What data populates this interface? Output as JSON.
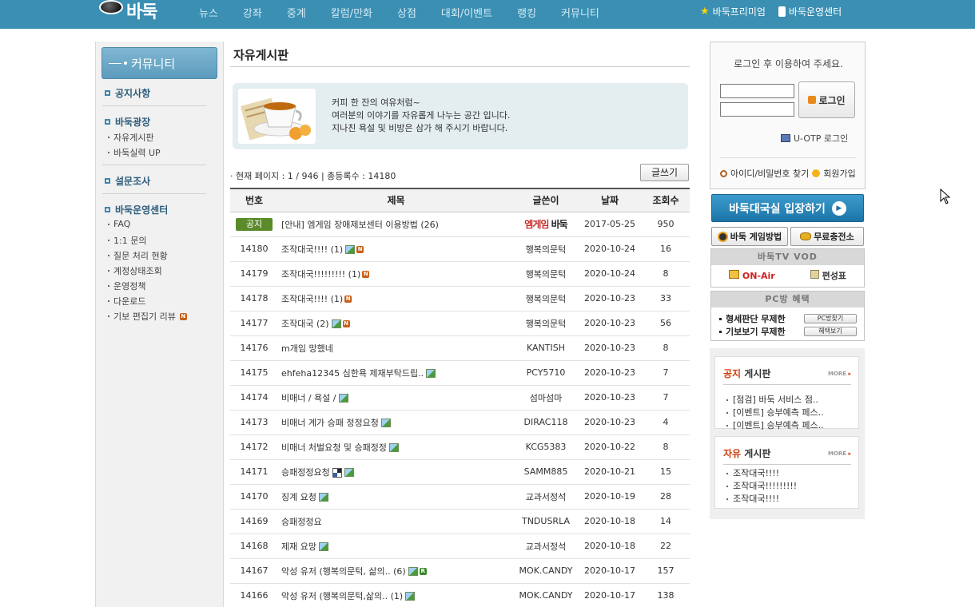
{
  "header": {
    "logo_text": "바둑",
    "nav": [
      "뉴스",
      "강좌",
      "중계",
      "칼럼/만화",
      "상점",
      "대회/이벤트",
      "랭킹",
      "커뮤니티"
    ],
    "premium": "바둑프리미엄",
    "ops_center": "바둑운영센터"
  },
  "sidebar": {
    "title": "커뮤니티",
    "sections": [
      {
        "label": "공지사항",
        "items": []
      },
      {
        "label": "바둑광장",
        "items": [
          "자유게시판",
          "바둑실력 UP"
        ]
      },
      {
        "label": "설문조사",
        "items": []
      },
      {
        "label": "바둑운영센터",
        "items": [
          "FAQ",
          "1:1 문의",
          "질문 처리 현황",
          "계정상태조회",
          "운영정책",
          "다운로드",
          "기보 편집기 리뷰"
        ]
      }
    ],
    "new_badge": "N"
  },
  "board": {
    "title": "자유게시판",
    "intro": [
      "커피 한 잔의 여유처럼~",
      "여러분의 이야기를 자유롭게 나누는 공간 입니다.",
      "지나친 욕설 및 비방은 삼가 해 주시기 바랍니다."
    ],
    "page_info": "· 현재 페이지 : 1 / 946  |  총등록수 : 14180",
    "write_button": "글쓰기",
    "columns": [
      "번호",
      "제목",
      "글쓴이",
      "날짜",
      "조회수"
    ],
    "notice": {
      "badge": "공지",
      "title": "[안내] 엠게임 장애제보센터 이용방법 (26)",
      "author_logo": "엠게임",
      "author_logo2": "바둑",
      "date": "2017-05-25",
      "views": "950"
    },
    "rows": [
      {
        "no": "14180",
        "title": "조작대국!!!! (1)",
        "img": true,
        "new": true,
        "reply": false,
        "qr": false,
        "author": "행복의문턱",
        "date": "2020-10-24",
        "views": "16"
      },
      {
        "no": "14179",
        "title": "조작대국!!!!!!!!! (1)",
        "img": false,
        "new": true,
        "reply": false,
        "qr": false,
        "author": "행복의문턱",
        "date": "2020-10-24",
        "views": "8"
      },
      {
        "no": "14178",
        "title": "조작대국!!!! (1)",
        "img": false,
        "new": true,
        "reply": false,
        "qr": false,
        "author": "행복의문턱",
        "date": "2020-10-23",
        "views": "33"
      },
      {
        "no": "14177",
        "title": "조작대국 (2)",
        "img": true,
        "new": true,
        "reply": false,
        "qr": false,
        "author": "행복의문턱",
        "date": "2020-10-23",
        "views": "56"
      },
      {
        "no": "14176",
        "title": "m개임 망했네",
        "img": false,
        "new": false,
        "reply": false,
        "qr": false,
        "author": "KANTISH",
        "date": "2020-10-23",
        "views": "8"
      },
      {
        "no": "14175",
        "title": "ehfeha12345 심한욕 제재부탁드립..",
        "img": true,
        "new": false,
        "reply": false,
        "qr": false,
        "author": "PCY5710",
        "date": "2020-10-23",
        "views": "7"
      },
      {
        "no": "14174",
        "title": "비매너 / 욕설 /",
        "img": true,
        "new": false,
        "reply": false,
        "qr": false,
        "author": "섬마섬마",
        "date": "2020-10-23",
        "views": "7"
      },
      {
        "no": "14173",
        "title": "비매너 계가 승패 정정요청",
        "img": true,
        "new": false,
        "reply": false,
        "qr": false,
        "author": "DIRAC118",
        "date": "2020-10-23",
        "views": "4"
      },
      {
        "no": "14172",
        "title": "비매너 처벌요청 및 승패정정",
        "img": true,
        "new": false,
        "reply": false,
        "qr": false,
        "author": "KCG5383",
        "date": "2020-10-22",
        "views": "8"
      },
      {
        "no": "14171",
        "title": "승패정정요청",
        "img": true,
        "new": false,
        "reply": false,
        "qr": true,
        "author": "SAMM885",
        "date": "2020-10-21",
        "views": "15"
      },
      {
        "no": "14170",
        "title": "징계 요청",
        "img": true,
        "new": false,
        "reply": false,
        "qr": false,
        "author": "교과서정석",
        "date": "2020-10-19",
        "views": "28"
      },
      {
        "no": "14169",
        "title": "승패정정요",
        "img": false,
        "new": false,
        "reply": false,
        "qr": false,
        "author": "TNDUSRLA",
        "date": "2020-10-18",
        "views": "14"
      },
      {
        "no": "14168",
        "title": "제재 요망",
        "img": true,
        "new": false,
        "reply": false,
        "qr": false,
        "author": "교과서정석",
        "date": "2020-10-18",
        "views": "22"
      },
      {
        "no": "14167",
        "title": "악성 유저 (행복의문턱, 삶의.. (6)",
        "img": true,
        "new": false,
        "reply": true,
        "qr": false,
        "author": "MOK.CANDY",
        "date": "2020-10-17",
        "views": "157"
      },
      {
        "no": "14166",
        "title": "악성 유저 (행복의문턱,삶의.. (1)",
        "img": true,
        "new": false,
        "reply": false,
        "qr": false,
        "author": "MOK.CANDY",
        "date": "2020-10-17",
        "views": "138"
      }
    ]
  },
  "login": {
    "message": "로그인 후 이용하여 주세요.",
    "button": "로그인",
    "otp": "U-OTP 로그인",
    "find": "아이디/비밀번호 찾기",
    "join": "회원가입"
  },
  "right": {
    "enter_button": "바둑대국실 입장하기",
    "howto": "바둑 게임방법",
    "charge": "무료충전소",
    "vod_title": "바둑TV VOD",
    "onair": "ON-Air",
    "schedule": "편성표",
    "pc_title": "PC방 혜택",
    "pc_rows": [
      {
        "label": "형세판단 무제한",
        "button": "PC방찾기"
      },
      {
        "label": "기보보기 무제한",
        "button": "혜택보기"
      }
    ],
    "notice_box": {
      "accent": "공지",
      "title": "게시판",
      "more": "MORE",
      "items": [
        "[점검] 바둑 서비스 점..",
        "[이벤트] 승부예측 페스..",
        "[이벤트] 승부예측 페스.."
      ]
    },
    "free_box": {
      "accent": "자유",
      "title": "게시판",
      "more": "MORE",
      "items": [
        "조작대국!!!!",
        "조작대국!!!!!!!!!",
        "조작대국!!!!"
      ]
    }
  },
  "colors": {
    "header_bg": "#3a8fb3",
    "accent_orange": "#d04010",
    "enter_button": "#1c74a8"
  }
}
